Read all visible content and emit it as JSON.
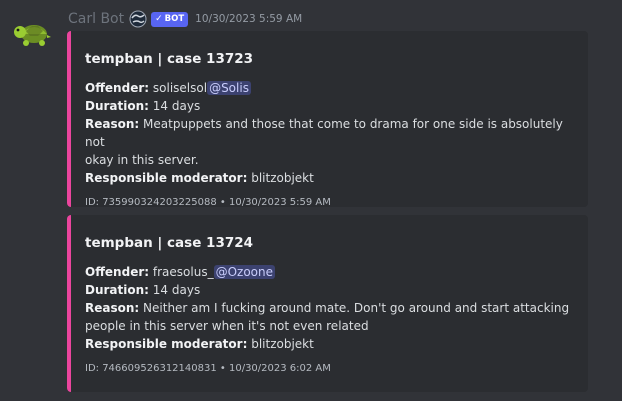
{
  "message": {
    "username": "Carl Bot",
    "bot_tag": "BOT",
    "timestamp": "10/30/2023 5:59 AM"
  },
  "colors": {
    "background": "#313338",
    "embed_background": "#2b2d31",
    "embed_accent": "#eb459e",
    "bot_tag": "#5865f2",
    "mention_bg": "#3c4270"
  },
  "icons": {
    "avatar": "turtle-avatar",
    "bot_emoji": "globe-icon",
    "bot_check": "checkmark-icon"
  },
  "embeds": [
    {
      "title": "tempban | case 13723",
      "offender_label": "Offender:",
      "offender_name": "soliselsol",
      "offender_mention": "@Solis",
      "duration_label": "Duration:",
      "duration_value": "14 days",
      "reason_label": "Reason:",
      "reason_value": "Meatpuppets and those that come to drama for one side is absolutely not",
      "reason_value_cont": "okay in this server.",
      "moderator_label": "Responsible moderator:",
      "moderator_value": "blitzobjekt",
      "footer": "ID: 735990324203225088 • 10/30/2023 5:59 AM"
    },
    {
      "title": "tempban | case 13724",
      "offender_label": "Offender:",
      "offender_name": "fraesolus_",
      "offender_mention": "@Ozoone",
      "duration_label": "Duration:",
      "duration_value": "14 days",
      "reason_label": "Reason:",
      "reason_value": "Neither am I fucking around mate. Don't go around and start attacking",
      "reason_value_cont": "people in this server when it's not even related",
      "moderator_label": "Responsible moderator:",
      "moderator_value": "blitzobjekt",
      "footer": "ID: 746609526312140831 • 10/30/2023 6:02 AM"
    }
  ]
}
